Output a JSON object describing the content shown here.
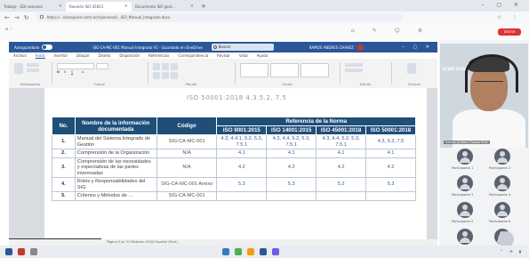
{
  "browser": {
    "tabs": [
      {
        "label": "Trabajo - EDI sesiones",
        "active": false
      },
      {
        "label": "Reunión ISO 45001",
        "active": true
      },
      {
        "label": "Documento ISO gest...",
        "active": false
      }
    ],
    "url": "https://...sharepoint.com/:w:/r/personal/...ISO_Manual_Integrado.docx",
    "red_button": "Unirse"
  },
  "word": {
    "autosave_label": "Autoguardado",
    "doc_title": "SIG-CA-MC-001 Manual Integrado V1 - Guardado en OneDrive",
    "search_placeholder": "Buscar",
    "user_name": "RAMOS ANDRES CHAVEZ",
    "menu": [
      "Archivo",
      "Inicio",
      "Insertar",
      "Dibujar",
      "Diseño",
      "Disposición",
      "Referencias",
      "Correspondencia",
      "Revisar",
      "Vista",
      "Ayuda"
    ],
    "active_menu": "Inicio",
    "ribbon_groups": [
      "Portapapeles",
      "Fuente",
      "Párrafo",
      "Estilos",
      "Edición",
      "Dictado"
    ],
    "status": "Página 5 de 31   Palabras: 6540   Español (Perú)"
  },
  "document": {
    "header_line": "ISO 50001:2018 4.3.5.2, 7.5",
    "table": {
      "headers": {
        "no": "No.",
        "name": "Nombre de la información documentada",
        "code": "Código",
        "reference": "Referencia de la Norma",
        "standards": [
          "ISO 9001:2015",
          "ISO 14001:2015",
          "ISO 45001:2018",
          "ISO 50001:2018"
        ]
      },
      "rows": [
        {
          "no": "1.",
          "name": "Manual del Sistema Integrado de Gestión",
          "code": "SIG-CA-MC-001",
          "refs": [
            "4.3, 4.4.1, 5.2, 5.3, 7.5.1",
            "4.3, 4.4, 5.2, 5.3, 7.5.1",
            "4.3, 4.4, 5.2, 5.3, 7.5.1",
            "4.3, 5.2, 7.5"
          ]
        },
        {
          "no": "2.",
          "name": "Comprensión de la Organización",
          "code": "N/A",
          "refs": [
            "4.1",
            "4.1",
            "4.1",
            "4.1"
          ]
        },
        {
          "no": "3.",
          "name": "Comprensión de las necesidades y expectativas de las partes interesadas",
          "code": "N/A",
          "refs": [
            "4.2",
            "4.2",
            "4.2",
            "4.2"
          ]
        },
        {
          "no": "4.",
          "name": "Roles y Responsabilidades del SIG",
          "code": "SIG-CA-MC-001 Anexo",
          "refs": [
            "5.3",
            "5.3",
            "5.3",
            "5.3"
          ]
        },
        {
          "no": "5.",
          "name": "Criterios y Métodos de ...",
          "code": "SIG-CA-MC-001",
          "refs": [
            "",
            "",
            "",
            ""
          ]
        }
      ]
    }
  },
  "meeting": {
    "presenter_logo": "ECHM ZOOM",
    "presenter_name": "Ramos Andres Chavez Ruiz",
    "participants": [
      {
        "name": "Participante 1"
      },
      {
        "name": "Participante 2"
      },
      {
        "name": "Participante 3"
      },
      {
        "name": "Participante 4"
      },
      {
        "name": "Participante 5"
      },
      {
        "name": "Participante 6"
      },
      {
        "name": "Participante 7"
      },
      {
        "name": "Participante 8"
      }
    ],
    "sharing_bar": "Está compartiendo pantalla · Detener presentación"
  },
  "colors": {
    "word_blue": "#2b579a",
    "table_header": "#1f4e79",
    "alert_red": "#dd3333"
  }
}
